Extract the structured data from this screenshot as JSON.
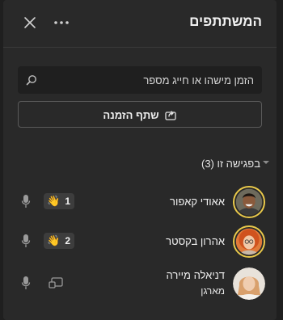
{
  "header": {
    "title": "המשתתפים",
    "more_icon": "more-horizontal-icon",
    "close_icon": "close-icon"
  },
  "search": {
    "placeholder": "הזמן מישהו או חייג מספר",
    "icon": "search-icon"
  },
  "share_invite": {
    "label": "שתף הזמנה",
    "icon": "share-icon"
  },
  "section": {
    "label": "בפגישה זו (3)",
    "icon": "chevron-down-icon"
  },
  "participants": [
    {
      "name": "אאודי קאפור",
      "subtitle": "",
      "raised_hand_order": "1",
      "hand_icon": "raised-hand-icon",
      "mic_icon": "microphone-icon"
    },
    {
      "name": "אהרון בקסטר",
      "subtitle": "",
      "raised_hand_order": "2",
      "hand_icon": "raised-hand-icon",
      "mic_icon": "microphone-icon"
    },
    {
      "name": "דניאלה מיירה",
      "subtitle": "מארגן",
      "mic_icon": "microphone-icon",
      "presenter_icon": "screen-share-icon"
    }
  ],
  "colors": {
    "panel_bg": "#292929",
    "page_bg": "#1f1f1f",
    "input_bg": "#1f1f1f",
    "raised_hand_ring": "#e8c84a",
    "text": "#f0f0f0"
  }
}
